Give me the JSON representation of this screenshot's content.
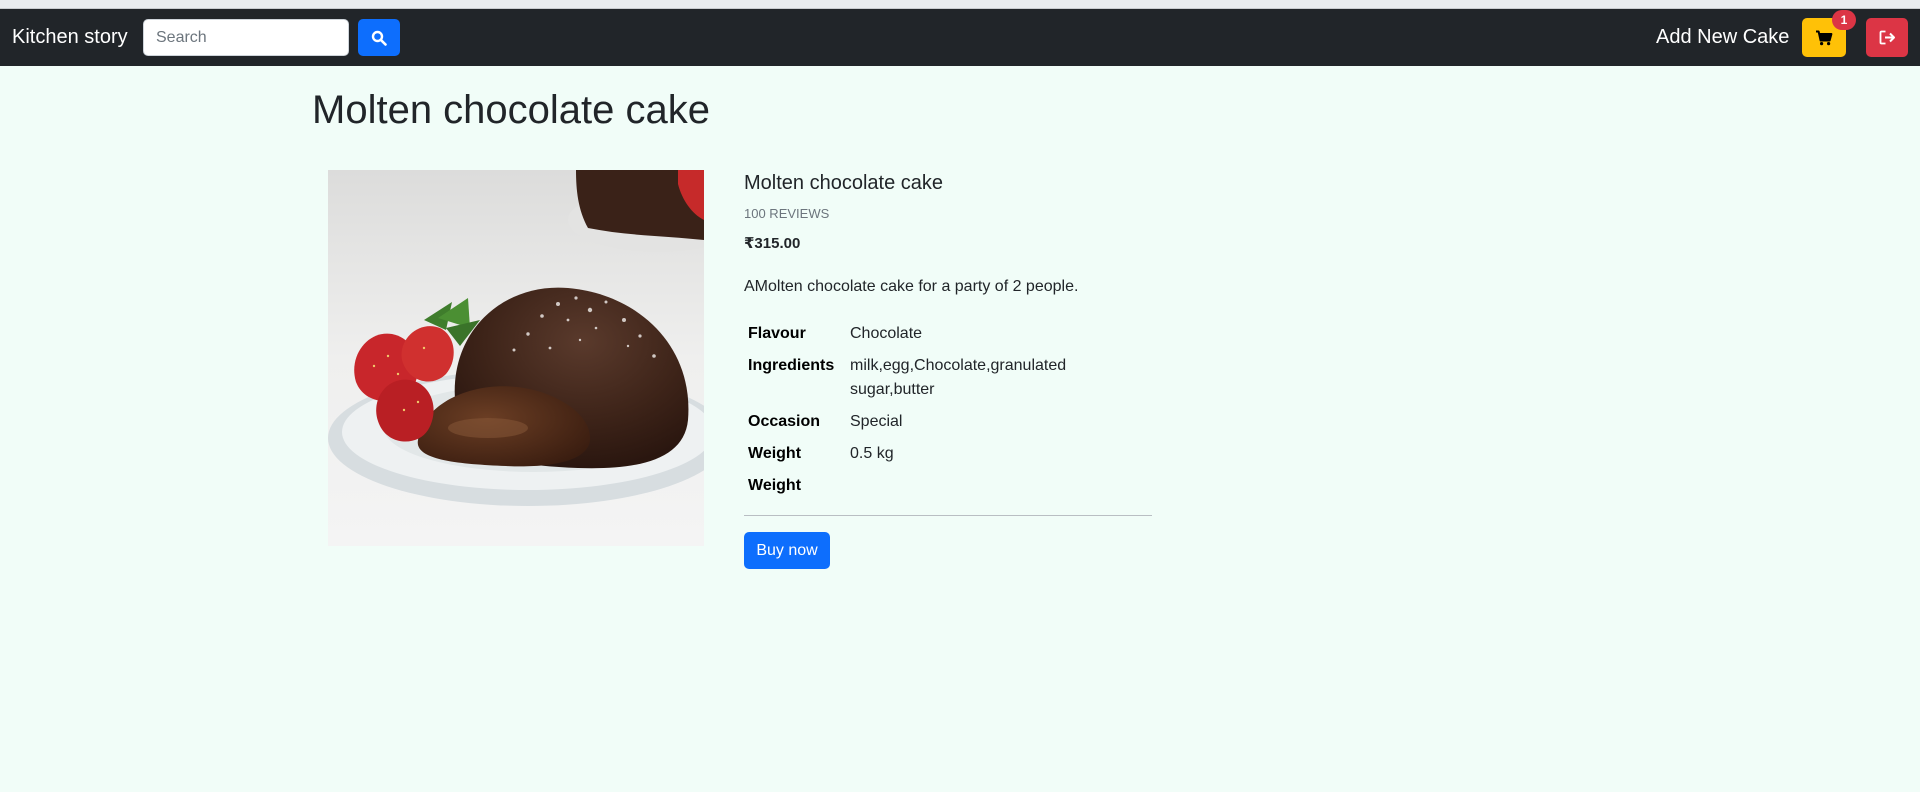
{
  "navbar": {
    "brand": "Kitchen story",
    "search_placeholder": "Search",
    "search_button_icon": "search-icon",
    "add_link": "Add New Cake",
    "cart_icon": "cart-icon",
    "cart_count": "1",
    "logout_icon": "logout-icon"
  },
  "page": {
    "title": "Molten chocolate cake"
  },
  "product": {
    "image_alt": "Molten chocolate cake",
    "name": "Molten chocolate cake",
    "reviews": "100 REVIEWS",
    "price": "₹315.00",
    "description": "AMolten chocolate cake for a party of 2 people.",
    "specs": [
      {
        "label": "Flavour",
        "value": "Chocolate"
      },
      {
        "label": "Ingredients",
        "value": "milk,egg,Chocolate,granulated sugar,butter"
      },
      {
        "label": "Occasion",
        "value": "Special"
      },
      {
        "label": "Weight",
        "value": "0.5 kg"
      },
      {
        "label": "Weight",
        "value": ""
      }
    ],
    "buy_label": "Buy now"
  },
  "colors": {
    "navbar": "#212529",
    "page_background": "#f1fdf8",
    "primary": "#0d6efd",
    "warning": "#ffc107",
    "danger": "#dc3545"
  }
}
